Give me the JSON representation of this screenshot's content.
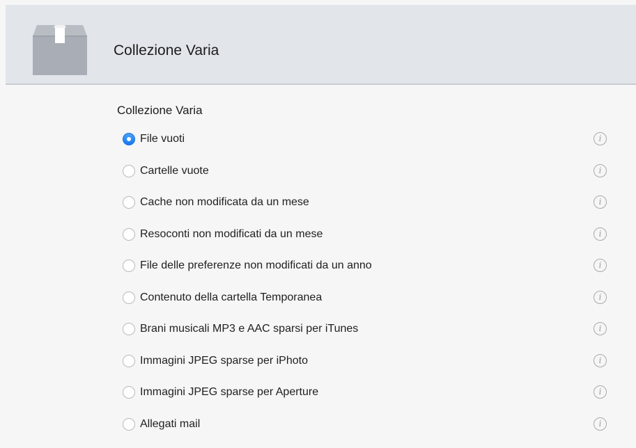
{
  "header": {
    "title": "Collezione Varia",
    "icon": "box-icon"
  },
  "section": {
    "title": "Collezione Varia"
  },
  "options": [
    {
      "label": "File vuoti",
      "selected": true,
      "info_icon": "info-icon"
    },
    {
      "label": "Cartelle vuote",
      "selected": false,
      "info_icon": "info-icon"
    },
    {
      "label": "Cache non modificata da un mese",
      "selected": false,
      "info_icon": "info-icon"
    },
    {
      "label": "Resoconti non modificati da un mese",
      "selected": false,
      "info_icon": "info-icon"
    },
    {
      "label": "File delle preferenze non modificati da un anno",
      "selected": false,
      "info_icon": "info-icon"
    },
    {
      "label": "Contenuto della cartella Temporanea",
      "selected": false,
      "info_icon": "info-icon"
    },
    {
      "label": "Brani musicali MP3 e AAC sparsi per iTunes",
      "selected": false,
      "info_icon": "info-icon"
    },
    {
      "label": "Immagini JPEG sparse per iPhoto",
      "selected": false,
      "info_icon": "info-icon"
    },
    {
      "label": "Immagini JPEG sparse per Aperture",
      "selected": false,
      "info_icon": "info-icon"
    },
    {
      "label": "Allegati mail",
      "selected": false,
      "info_icon": "info-icon"
    }
  ],
  "colors": {
    "accent": "#1678f0",
    "header_bg": "#e2e5ea",
    "content_bg": "#f6f6f6"
  }
}
